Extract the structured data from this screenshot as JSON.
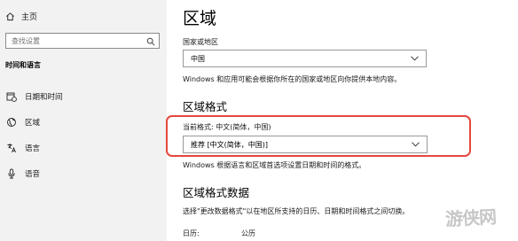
{
  "sidebar": {
    "home_label": "主页",
    "search_placeholder": "查找设置",
    "section_title": "时间和语言",
    "items": [
      {
        "label": "日期和时间",
        "icon": "calendar-clock-icon"
      },
      {
        "label": "区域",
        "icon": "globe-icon"
      },
      {
        "label": "语言",
        "icon": "language-icon"
      },
      {
        "label": "语音",
        "icon": "microphone-icon"
      }
    ]
  },
  "main": {
    "title": "区域",
    "country": {
      "label": "国家或地区",
      "value": "中国",
      "description": "Windows 和应用可能会根据你所在的国家或地区向你提供本地内容。"
    },
    "format": {
      "title": "区域格式",
      "current_label": "当前格式: 中文(简体，中国)",
      "value": "推荐 [中文(简体，中国)]",
      "description": "Windows 根据语言和区域首选项设置日期和时间的格式。"
    },
    "data": {
      "title": "区域格式数据",
      "description": "选择\"更改数据格式\"以在地区所支持的日历、日期和时间格式之间切换。",
      "calendar_label": "日历:",
      "calendar_value": "公历"
    }
  },
  "watermark": "游侠网",
  "colors": {
    "sidebar_bg": "#f2f2f2",
    "highlight": "#e5473d"
  }
}
